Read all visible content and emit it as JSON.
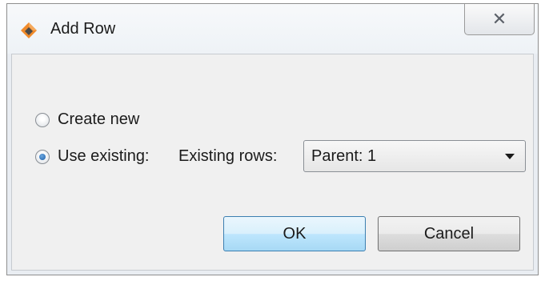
{
  "window": {
    "title": "Add Row",
    "close_glyph": "✕",
    "icon": "app-diamond-icon",
    "colors": {
      "icon_orange": "#f08a2a",
      "icon_dark": "#4a4a4a"
    }
  },
  "options": {
    "create_new": {
      "label": "Create new",
      "checked": false
    },
    "use_existing": {
      "label": "Use existing:",
      "checked": true
    }
  },
  "existing_rows": {
    "label": "Existing rows:",
    "selected": "Parent: 1"
  },
  "buttons": {
    "ok": "OK",
    "cancel": "Cancel"
  }
}
